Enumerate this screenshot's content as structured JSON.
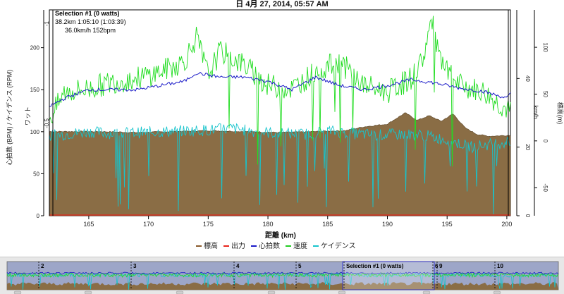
{
  "window": {
    "title": "日 4月 27, 2014, 05:57 AM"
  },
  "selection": {
    "label": "Selection #1 (0 watts)",
    "line2": "38.2km 1:05:10 (1:03:39)",
    "line3": "36.0km/h  152bpm"
  },
  "axes": {
    "xlabel": "距離 (km)",
    "ylabel_left_outer": "心拍数 (BPM) / ケイデンス (RPM)",
    "ylabel_left_inner": "ワット",
    "ylabel_right_inner": "km/h",
    "ylabel_right_outer": "標高(m)"
  },
  "legend": [
    {
      "label": "標高",
      "color": "#8a5a2b"
    },
    {
      "label": "出力",
      "color": "#e8241b"
    },
    {
      "label": "心拍数",
      "color": "#1a1ac8"
    },
    {
      "label": "速度",
      "color": "#22cc22"
    },
    {
      "label": "ケイデンス",
      "color": "#17c4cc"
    }
  ],
  "overview": {
    "markers": [
      "2",
      "3",
      "4",
      "5",
      "Selection #1 (0 watts)",
      "6",
      "9",
      "10"
    ]
  },
  "colors": {
    "altitude": "#8a6d45",
    "power": "#e8241b",
    "hr": "#1a1ac8",
    "speed": "#22dd22",
    "cadence": "#17c4cc"
  },
  "chart_data": {
    "type": "line",
    "x_range": [
      161.7,
      200.3
    ],
    "x_ticks": [
      165,
      170,
      175,
      180,
      185,
      190,
      195,
      200
    ],
    "y_left_outer": {
      "range": [
        0,
        245
      ],
      "ticks": [
        0,
        50,
        100,
        150,
        200
      ]
    },
    "y_left_inner": {
      "range": [
        -1.05,
        1.05
      ],
      "ticks": [
        "-1",
        "-0.5",
        "0",
        "0.5",
        "1"
      ]
    },
    "y_right_inner": {
      "range": [
        0,
        60
      ],
      "ticks": [
        0,
        20,
        40
      ]
    },
    "y_right_outer": {
      "range": [
        -80,
        140
      ],
      "ticks": [
        -50,
        0,
        50,
        100
      ]
    },
    "series": [
      {
        "name": "標高",
        "x": [
          161.7,
          166,
          169,
          172,
          175,
          178,
          181,
          184,
          186.5,
          188,
          190,
          191.5,
          192.5,
          193.5,
          194.5,
          195.5,
          196.5,
          197.5,
          198.5,
          200.3
        ],
        "values": [
          10,
          10,
          9,
          10,
          11,
          10,
          9,
          10,
          11,
          15,
          18,
          30,
          22,
          27,
          21,
          29,
          14,
          7,
          5,
          6
        ]
      },
      {
        "name": "心拍数",
        "x": [
          161.7,
          163,
          165,
          167,
          169,
          171,
          173,
          174,
          176,
          178,
          180,
          182,
          184,
          186,
          188,
          190,
          192,
          194,
          196,
          198,
          200,
          200.3
        ],
        "values": [
          130,
          140,
          150,
          150,
          150,
          155,
          160,
          170,
          165,
          165,
          160,
          150,
          165,
          155,
          150,
          155,
          162,
          158,
          152,
          148,
          140,
          145
        ]
      },
      {
        "name": "速度",
        "x": [
          161.7,
          163,
          165,
          167,
          169,
          171,
          173,
          174,
          175,
          176,
          178,
          180,
          182,
          184,
          186,
          188,
          190,
          192,
          193,
          193.7,
          194.5,
          196,
          198,
          200.3
        ],
        "values": [
          28,
          36,
          37,
          39,
          40,
          42,
          45,
          52,
          41,
          48,
          44,
          38,
          37,
          42,
          45,
          38,
          36,
          40,
          46,
          57,
          44,
          38,
          36,
          30
        ]
      },
      {
        "name": "ケイデンス",
        "x": [
          161.7,
          163,
          165,
          167,
          169,
          171,
          173,
          175,
          177,
          179,
          181,
          183,
          185,
          187,
          189,
          191,
          193,
          195,
          197,
          199,
          200.3
        ],
        "values": [
          95,
          97,
          100,
          98,
          99,
          100,
          101,
          102,
          104,
          100,
          98,
          97,
          101,
          98,
          96,
          97,
          96,
          90,
          82,
          86,
          88
        ]
      },
      {
        "name": "出力",
        "x": [
          161.7,
          200.3
        ],
        "values": [
          0,
          0
        ]
      }
    ]
  }
}
